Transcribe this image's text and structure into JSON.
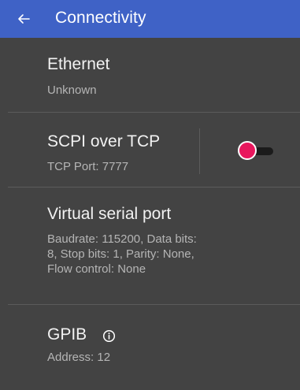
{
  "appbar": {
    "back_icon": "arrow-left-icon",
    "title": "Connectivity"
  },
  "items": {
    "ethernet": {
      "title": "Ethernet",
      "subtitle": "Unknown"
    },
    "scpi": {
      "title": "SCPI over TCP",
      "subtitle": "TCP Port: 7777",
      "toggle_on": false
    },
    "serial": {
      "title": "Virtual serial port",
      "subtitle": "Baudrate: 115200, Data bits: 8, Stop bits: 1, Parity: None, Flow control: None"
    },
    "gpib": {
      "title": "GPIB",
      "info_icon": "info-circle-icon",
      "subtitle": "Address: 12"
    }
  },
  "colors": {
    "appbar": "#3f62c6",
    "background": "#434343",
    "toggle_thumb": "#e8175d"
  }
}
